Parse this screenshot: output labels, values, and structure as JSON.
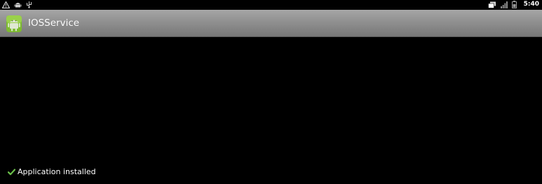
{
  "status_bar": {
    "left_icons": [
      "warning-icon",
      "android-debug-icon",
      "usb-icon"
    ],
    "right_icons": [
      "screenshot-icon",
      "signal-icon",
      "battery-icon"
    ],
    "time": "5:40"
  },
  "title_bar": {
    "app_icon": "android-app-icon",
    "title": "IOSService",
    "background_color": "#909090"
  },
  "content": {
    "status_icon": "check-icon",
    "status_icon_color": "#6cc04a",
    "status_text": "Application installed"
  }
}
